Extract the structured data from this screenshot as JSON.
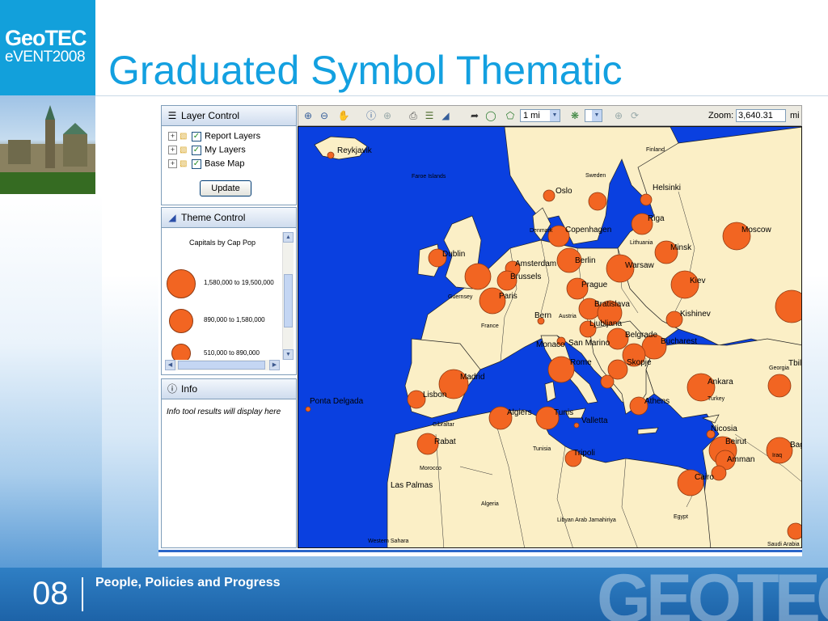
{
  "slide": {
    "title": "Graduated Symbol Thematic",
    "logo_line1": "GeoTEC",
    "logo_line2": "eVENT2008",
    "footer_number": "08",
    "footer_text": "People, Policies and Progress",
    "footer_logo": "GEOTEC"
  },
  "layer_control": {
    "title": "Layer Control",
    "items": [
      {
        "label": "Report Layers",
        "checked": true
      },
      {
        "label": "My Layers",
        "checked": true
      },
      {
        "label": "Base Map",
        "checked": true
      }
    ],
    "update_label": "Update"
  },
  "theme_control": {
    "title": "Theme Control",
    "legend_title": "Capitals by Cap Pop",
    "legend": [
      {
        "label": "1,580,000 to 19,500,000"
      },
      {
        "label": "890,000 to 1,580,000"
      },
      {
        "label": "510,000 to 890,000"
      }
    ]
  },
  "info": {
    "title": "Info",
    "text": "Info tool results will display here"
  },
  "toolbar": {
    "scale_value": "1 mi",
    "zoom_label": "Zoom:",
    "zoom_value": "3,640.31",
    "zoom_unit": "mi"
  },
  "map_labels": [
    "Reykjavik",
    "Faroe Islands",
    "Oslo",
    "Sweden",
    "Finland",
    "Helsinki",
    "Riga",
    "Moscow",
    "Lithuania",
    "Minsk",
    "Denmark",
    "Copenhagen",
    "Berlin",
    "Warsaw",
    "Kiev",
    "Dublin",
    "Amsterdam",
    "Brussels",
    "Prague",
    "Guernsey",
    "Paris",
    "Bratislava",
    "France",
    "Bern",
    "Austria",
    "Ljubljana",
    "Kishinev",
    "Monaco",
    "San Marino",
    "Belgrade",
    "Bucharest",
    "Georgia",
    "Tbilisi",
    "Madrid",
    "Rome",
    "Skopje",
    "Ankara",
    "Turkey",
    "Lisbon",
    "Ponta Delgada",
    "Athens",
    "Algiers",
    "Tunis",
    "Valletta",
    "Nicosia",
    "Beirut",
    "Rabat",
    "Gibraltar",
    "Tunisia",
    "Tripoli",
    "Iraq",
    "Amman",
    "Baghdad",
    "Morocco",
    "Cairo",
    "Las Palmas",
    "Algeria",
    "Libyan Arab Jamahiriya",
    "Egypt",
    "Western Sahara",
    "Saudi Arabia"
  ],
  "colors": {
    "sea": "#0a40e0",
    "land": "#fbefc6",
    "symbol": "#f26522",
    "title": "#13a0e0",
    "logo_bg": "#12a0db",
    "footer": "#2f7fc4"
  }
}
